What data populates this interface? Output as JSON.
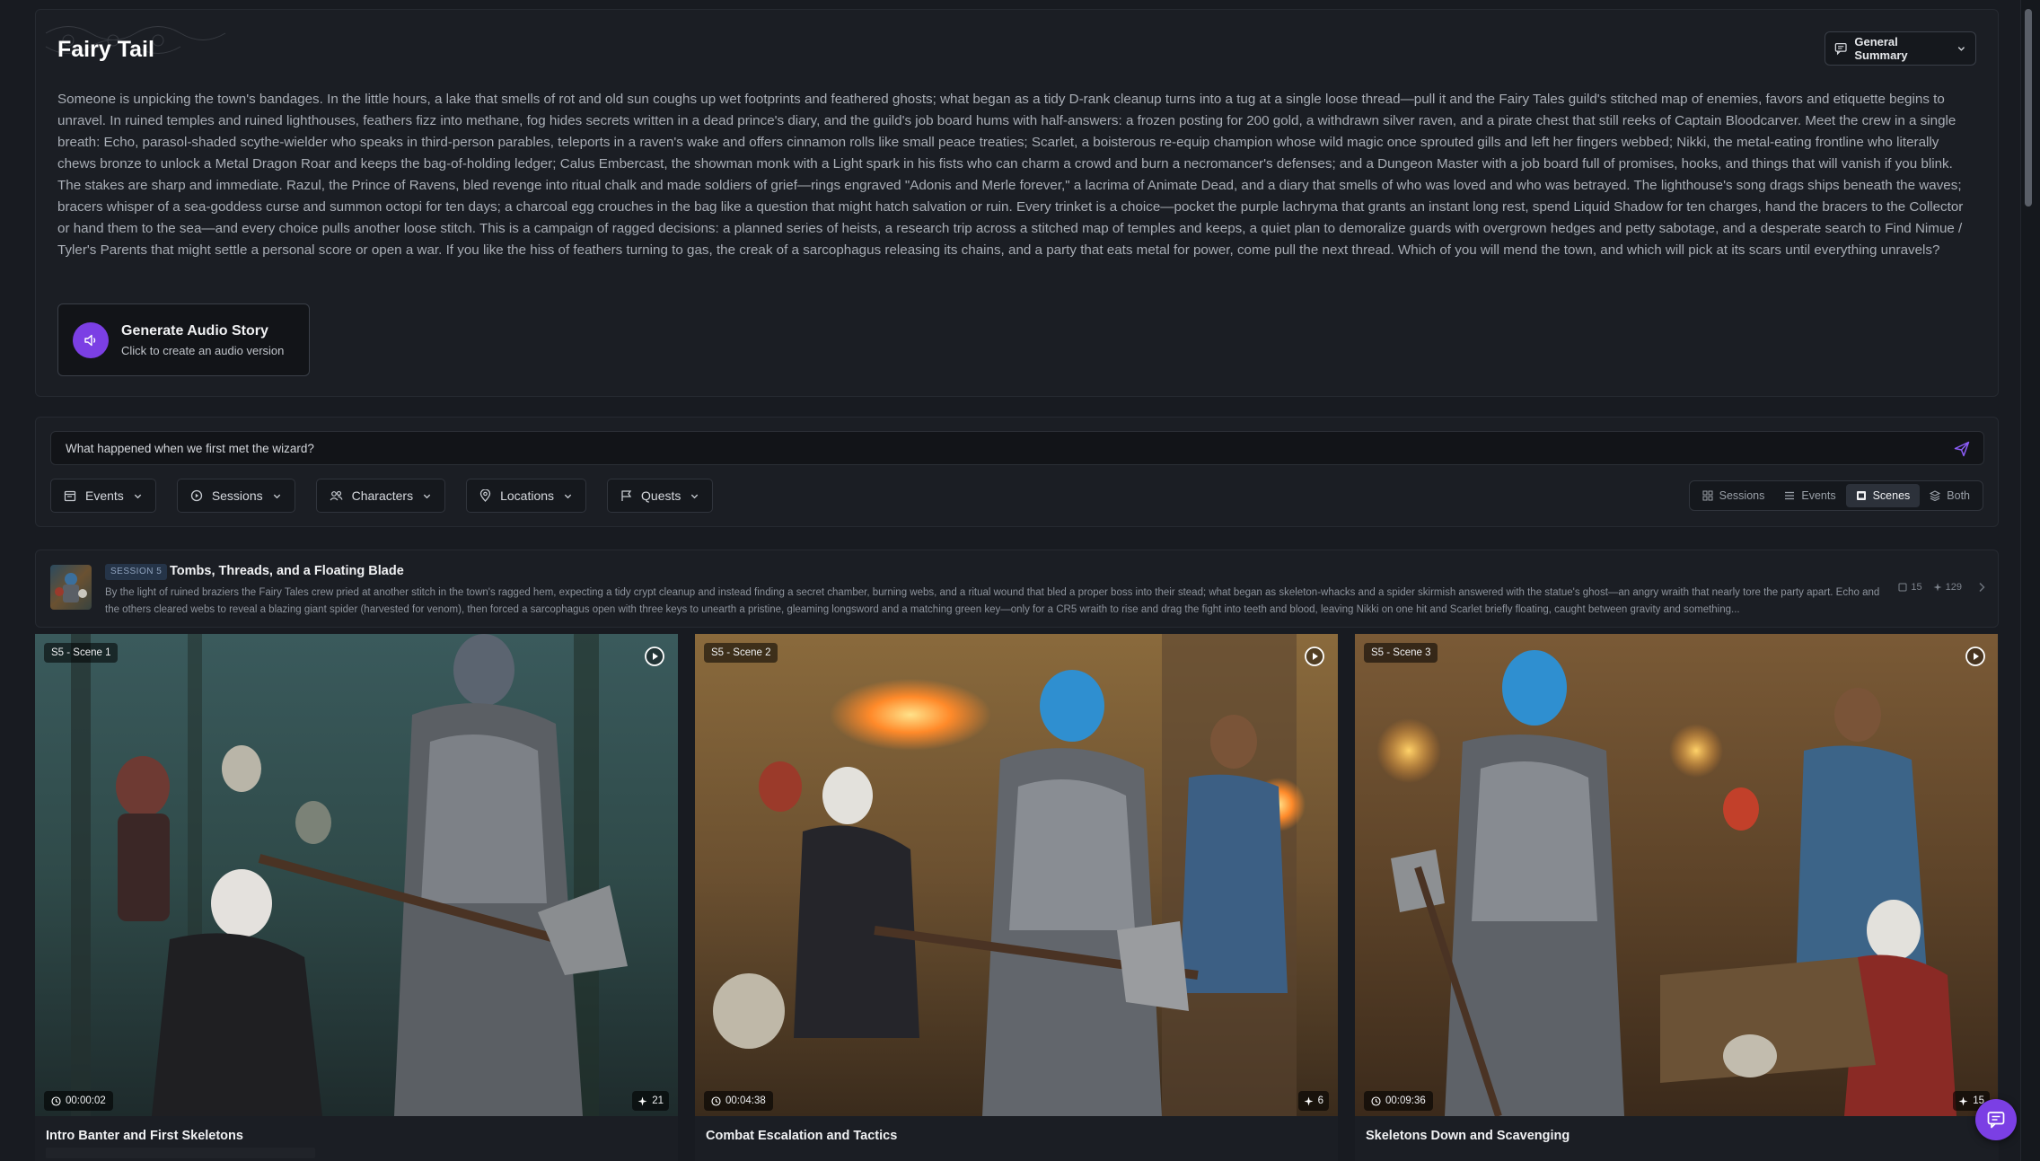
{
  "header": {
    "title": "Fairy Tail",
    "summary_dropdown_label": "General Summary"
  },
  "summary": {
    "text": "Someone is unpicking the town's bandages. In the little hours, a lake that smells of rot and old sun coughs up wet footprints and feathered ghosts; what began as a tidy D-rank cleanup turns into a tug at a single loose thread—pull it and the Fairy Tales guild's stitched map of enemies, favors and etiquette begins to unravel. In ruined temples and ruined lighthouses, feathers fizz into methane, fog hides secrets written in a dead prince's diary, and the guild's job board hums with half-answers: a frozen posting for 200 gold, a withdrawn silver raven, and a pirate chest that still reeks of Captain Bloodcarver. Meet the crew in a single breath: Echo, parasol-shaded scythe-wielder who speaks in third-person parables, teleports in a raven's wake and offers cinnamon rolls like small peace treaties; Scarlet, a boisterous re-equip champion whose wild magic once sprouted gills and left her fingers webbed; Nikki, the metal-eating frontline who literally chews bronze to unlock a Metal Dragon Roar and keeps the bag-of-holding ledger; Calus Embercast, the showman monk with a Light spark in his fists who can charm a crowd and burn a necromancer's defenses; and a Dungeon Master with a job board full of promises, hooks, and things that will vanish if you blink. The stakes are sharp and immediate. Razul, the Prince of Ravens, bled revenge into ritual chalk and made soldiers of grief—rings engraved \"Adonis and Merle forever,\" a lacrima of Animate Dead, and a diary that smells of who was loved and who was betrayed. The lighthouse's song drags ships beneath the waves; bracers whisper of a sea-goddess curse and summon octopi for ten days; a charcoal egg crouches in the bag like a question that might hatch salvation or ruin. Every trinket is a choice—pocket the purple lachryma that grants an instant long rest, spend Liquid Shadow for ten charges, hand the bracers to the Collector or hand them to the sea—and every choice pulls another loose stitch. This is a campaign of ragged decisions: a planned series of heists, a research trip across a stitched map of temples and keeps, a quiet plan to demoralize guards with overgrown hedges and petty sabotage, and a desperate search to Find Nimue / Tyler's Parents that might settle a personal score or open a war. If you like the hiss of feathers turning to gas, the creak of a sarcophagus releasing its chains, and a party that eats metal for power, come pull the next thread. Which of you will mend the town, and which will pick at its scars until everything unravels?",
    "audio": {
      "title": "Generate Audio Story",
      "subtitle": "Click to create an audio version"
    }
  },
  "query": {
    "value": "What happened when we first met the wizard?",
    "filters": [
      {
        "label": "Events",
        "icon": "calendar-icon"
      },
      {
        "label": "Sessions",
        "icon": "play-circle-icon"
      },
      {
        "label": "Characters",
        "icon": "users-icon"
      },
      {
        "label": "Locations",
        "icon": "map-pin-icon"
      },
      {
        "label": "Quests",
        "icon": "flag-icon"
      }
    ],
    "view_options": [
      {
        "label": "Sessions",
        "active": false
      },
      {
        "label": "Events",
        "active": false
      },
      {
        "label": "Scenes",
        "active": true
      },
      {
        "label": "Both",
        "active": false
      }
    ]
  },
  "session": {
    "badge": "SESSION 5",
    "title": "Tombs, Threads, and a Floating Blade",
    "description": "By the light of ruined braziers the Fairy Tales crew pried at another stitch in the town's ragged hem, expecting a tidy crypt cleanup and instead finding a secret chamber, burning webs, and a ritual wound that bled a proper boss into their stead; what began as skeleton-whacks and a spider skirmish answered with the statue's ghost—an angry wraith that nearly tore the party apart. Echo and the others cleared webs to reveal a blazing giant spider (harvested for venom), then forced a sarcophagus open with three keys to unearth a pristine, gleaming longsword and a matching green key—only for a CR5 wraith to rise and drag the fight into teeth and blood, leaving Nikki on one hit and Scarlet briefly floating, caught between gravity and something...",
    "scene_count": "15",
    "event_count": "129"
  },
  "scenes": [
    {
      "tag": "S5 - Scene 1",
      "time": "00:00:02",
      "count": "21",
      "title": "Intro Banter and First Skeletons"
    },
    {
      "tag": "S5 - Scene 2",
      "time": "00:04:38",
      "count": "6",
      "title": "Combat Escalation and Tactics"
    },
    {
      "tag": "S5 - Scene 3",
      "time": "00:09:36",
      "count": "15",
      "title": "Skeletons Down and Scavenging"
    }
  ],
  "colors": {
    "accent": "#7b3fe4",
    "background": "#181b21",
    "card": "#1b1e24"
  }
}
